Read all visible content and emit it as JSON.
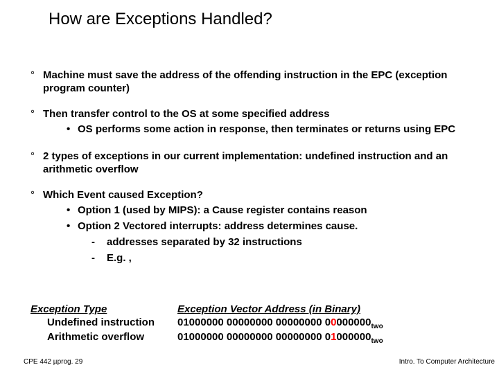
{
  "title": "How are Exceptions Handled?",
  "bullets": {
    "b1a": "Machine must save the address of the offending instruction in the EPC (exception program counter)",
    "b1b": "Then transfer control  to the OS at some specified address",
    "b1b_s1": "OS performs some action in response, then terminates or returns using EPC",
    "b1c": "2  types of exceptions in our current implementation: undefined instruction and an arithmetic overflow",
    "b1d": "Which Event caused Exception?",
    "b1d_s1": "Option 1 (used by MIPS): a Cause register contains reason",
    "b1d_s2": "Option 2 Vectored interrupts: address determines cause.",
    "b1d_s2_a": "addresses separated by 32 instructions",
    "b1d_s2_b": "E.g. ,"
  },
  "table": {
    "header1": "Exception Type",
    "header2": "Exception Vector Address (in Binary)",
    "rows": [
      {
        "name": "Undefined instruction",
        "binary_pre": "01000000 00000000 00000000 0",
        "binary_red": "0",
        "binary_post": "000000",
        "sub": "two"
      },
      {
        "name": "Arithmetic overflow",
        "binary_pre": "01000000 00000000 00000000 0",
        "binary_red": "1",
        "binary_post": "000000",
        "sub": "two"
      }
    ]
  },
  "footer": {
    "left": "CPE 442  µprog. 29",
    "right": "Intro. To Computer Architecture"
  },
  "chart_data": {
    "type": "table",
    "title": "Exception Vector Address (in Binary)",
    "columns": [
      "Exception Type",
      "Exception Vector Address (in Binary)"
    ],
    "rows": [
      [
        "Undefined instruction",
        "01000000 00000000 00000000 00000000 (two)"
      ],
      [
        "Arithmetic overflow",
        "01000000 00000000 00000000 01000000 (two)"
      ]
    ]
  }
}
